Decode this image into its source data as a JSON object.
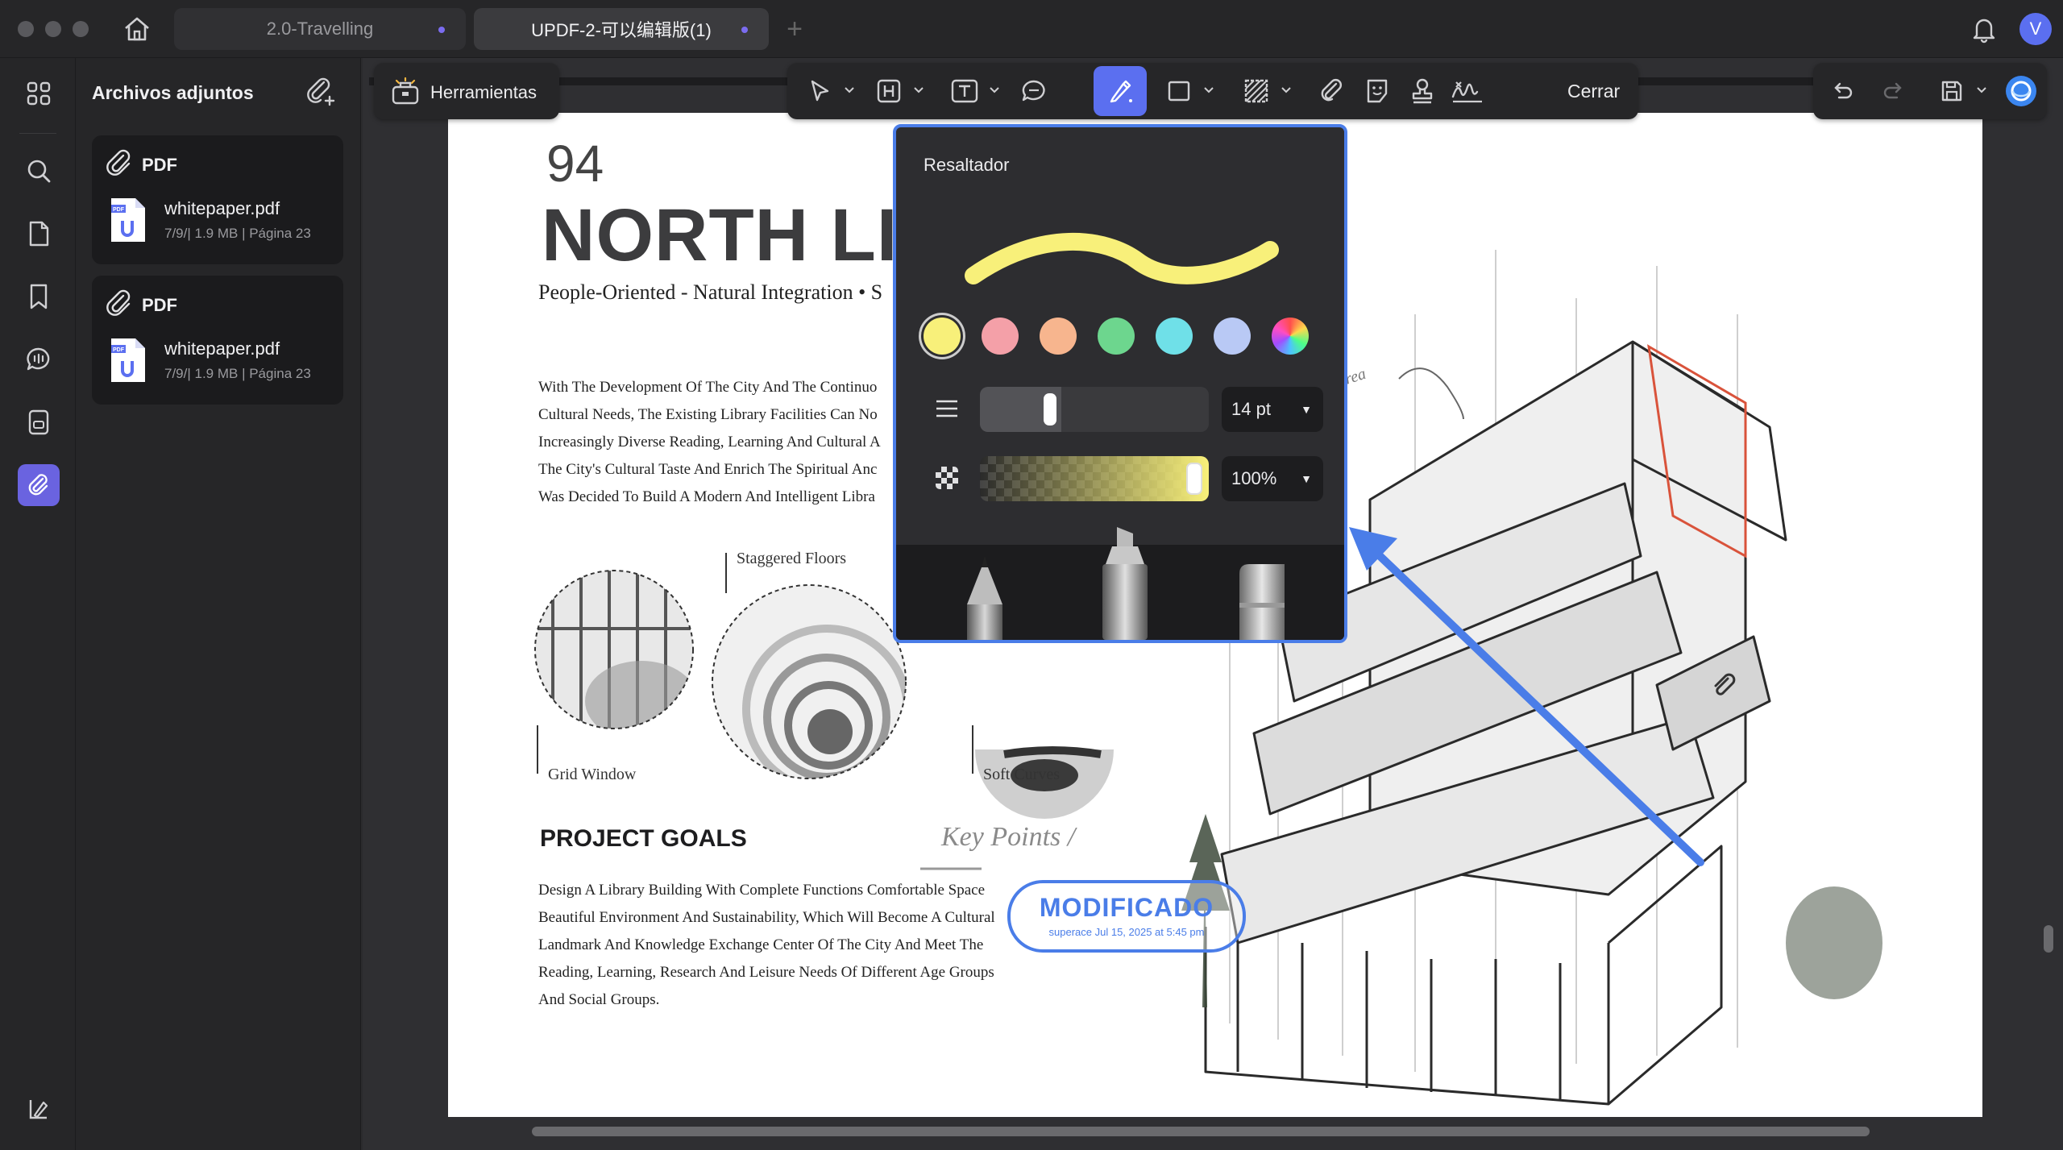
{
  "tabs": [
    {
      "label": "2.0-Travelling",
      "active": false
    },
    {
      "label": "UPDF-2-可以编辑版(1)",
      "active": true
    }
  ],
  "user": {
    "avatar_letter": "V"
  },
  "panel": {
    "title": "Archivos adjuntos",
    "attachments": [
      {
        "type": "PDF",
        "name": "whitepaper.pdf",
        "meta": "7/9/| 1.9 MB | Página 23"
      },
      {
        "type": "PDF",
        "name": "whitepaper.pdf",
        "meta": "7/9/| 1.9 MB | Página 23"
      }
    ]
  },
  "toolbar": {
    "tools_label": "Herramientas",
    "close_label": "Cerrar"
  },
  "highlighter": {
    "title": "Resaltador",
    "selected_color": "#f8f07a",
    "colors": [
      "#f8f07a",
      "#f4a0a8",
      "#f7b58e",
      "#6dd68e",
      "#6fe0e8",
      "#b9c9f5",
      "rainbow"
    ],
    "size": "14 pt",
    "opacity": "100%",
    "size_value": 14,
    "opacity_value": 1.0
  },
  "document": {
    "page_number": "94",
    "title": "NORTH LI",
    "subtitle": "People-Oriented - Natural Integration • S",
    "intro_lines": [
      "With The Development Of The City And The Continuo",
      "Cultural Needs, The Existing Library Facilities Can No",
      "Increasingly Diverse Reading, Learning And Cultural A",
      "The City's Cultural Taste And Enrich The Spiritual Anc",
      "Was Decided To Build A Modern And Intelligent Libra"
    ],
    "labels": {
      "staggered_floors": "Staggered Floors",
      "grid_window": "Grid Window",
      "soft_curves": "Soft Curves",
      "key_points": "Key Points /",
      "area": "area"
    },
    "section_heading": "PROJECT GOALS",
    "goal_lines": [
      "Design A Library Building With Complete Functions Comfortable Space",
      "Beautiful Environment And Sustainability, Which Will Become A Cultural",
      "Landmark And Knowledge Exchange Center Of The City And Meet The",
      "Reading, Learning, Research And Leisure Needs Of Different Age Groups",
      "And Social Groups."
    ],
    "stamp": {
      "main": "MODIFICADO",
      "sub": "superace Jul 15, 2025 at 5:45 pm"
    }
  },
  "colors": {
    "accent": "#5b6ff0",
    "arrow": "#4a7de8"
  }
}
